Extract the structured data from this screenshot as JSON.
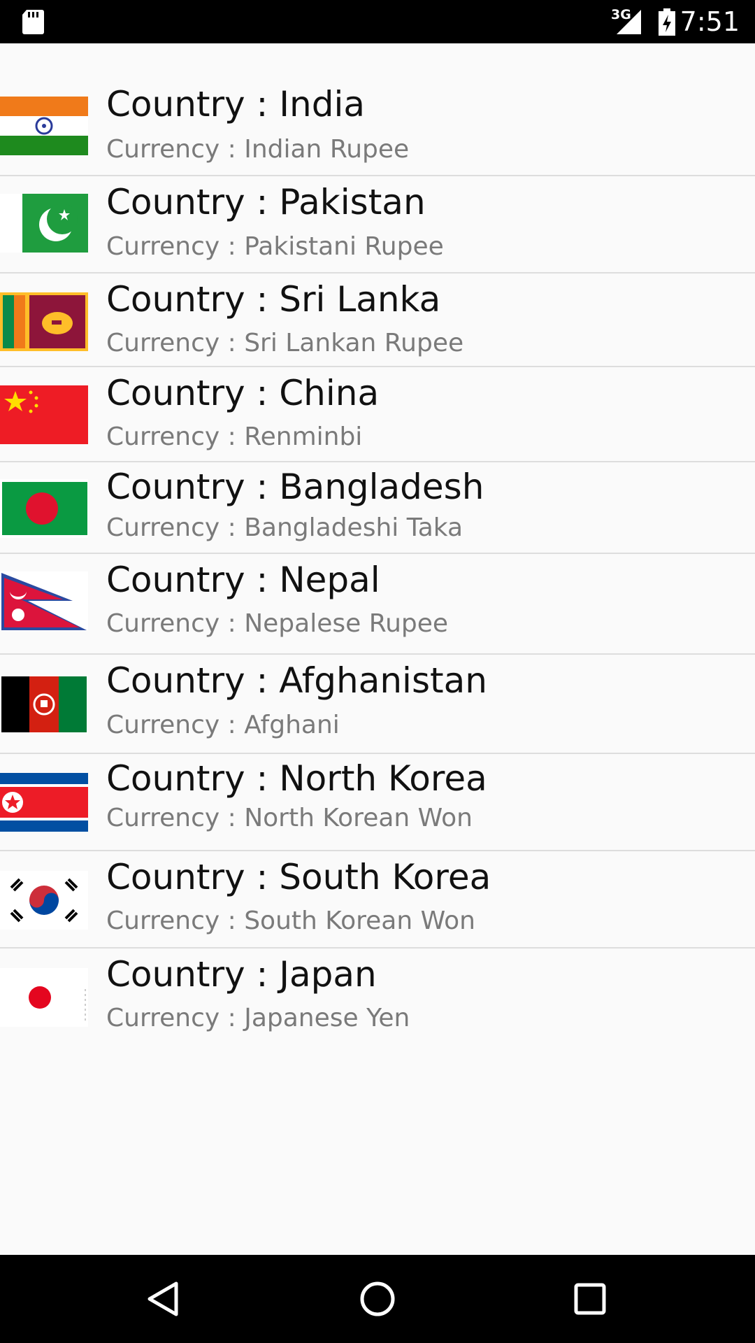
{
  "status_bar": {
    "network_type": "3G",
    "time": "7:51",
    "icons": [
      "sd-card-icon",
      "signal-icon",
      "battery-charging-icon"
    ]
  },
  "countries": [
    {
      "country": "Country : India",
      "currency": "Currency : Indian Rupee",
      "flag_icon": "india-flag-icon"
    },
    {
      "country": "Country : Pakistan",
      "currency": "Currency : Pakistani Rupee",
      "flag_icon": "pakistan-flag-icon"
    },
    {
      "country": "Country : Sri Lanka",
      "currency": "Currency : Sri Lankan Rupee",
      "flag_icon": "sri-lanka-flag-icon"
    },
    {
      "country": "Country : China",
      "currency": "Currency : Renminbi",
      "flag_icon": "china-flag-icon"
    },
    {
      "country": "Country : Bangladesh",
      "currency": "Currency : Bangladeshi Taka",
      "flag_icon": "bangladesh-flag-icon"
    },
    {
      "country": "Country : Nepal",
      "currency": "Currency : Nepalese Rupee",
      "flag_icon": "nepal-flag-icon"
    },
    {
      "country": "Country : Afghanistan",
      "currency": "Currency : Afghani",
      "flag_icon": "afghanistan-flag-icon"
    },
    {
      "country": "Country : North Korea",
      "currency": "Currency : North Korean Won",
      "flag_icon": "north-korea-flag-icon"
    },
    {
      "country": "Country : South Korea",
      "currency": "Currency : South Korean Won",
      "flag_icon": "south-korea-flag-icon"
    },
    {
      "country": "Country : Japan",
      "currency": "Currency : Japanese Yen",
      "flag_icon": "japan-flag-icon"
    }
  ],
  "nav_bar": {
    "icons": [
      "back-icon",
      "home-icon",
      "recents-icon"
    ]
  },
  "colors": {
    "status_bar": "#000000",
    "nav_bar": "#000000",
    "background": "#fafafa",
    "country_text": "#111111",
    "currency_text": "#7a7a7a",
    "divider": "#dddddd"
  }
}
